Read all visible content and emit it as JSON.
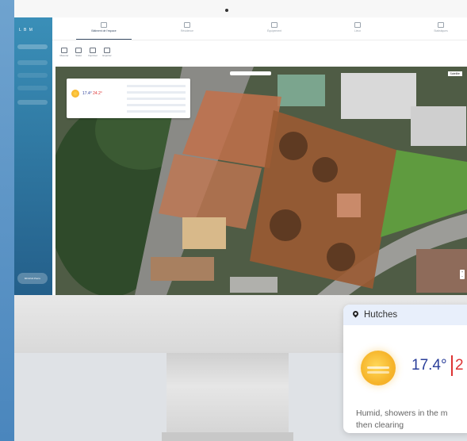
{
  "app": {
    "logo": "L B M",
    "tabs": [
      {
        "label": "Bâtiment de l'espace",
        "active": true
      },
      {
        "label": "Résidence",
        "active": false
      },
      {
        "label": "Équipement",
        "active": false
      },
      {
        "label": "Lieux",
        "active": false
      },
      {
        "label": "Statistiques",
        "active": false
      }
    ],
    "tools": [
      "Mesurer",
      "Statut",
      "Imprimer",
      "Exporter"
    ],
    "sidebar_user": "MOLINA Pierre"
  },
  "map": {
    "type_label": "Satellite",
    "zoom_in": "+",
    "zoom_out": "−"
  },
  "popup": {
    "temp": "17.4°",
    "temp_max": "24.2°",
    "location": "Hutches"
  },
  "weather_card": {
    "location": "Hutches",
    "temperature": "17.4°",
    "temperature_max": "2",
    "description_line1": "Humid, showers in the m",
    "description_line2": "then clearing",
    "icon": "sun-icon"
  },
  "colors": {
    "temp_blue": "#2b3f9a",
    "temp_red": "#d33333",
    "header_bg": "#e8effb"
  }
}
